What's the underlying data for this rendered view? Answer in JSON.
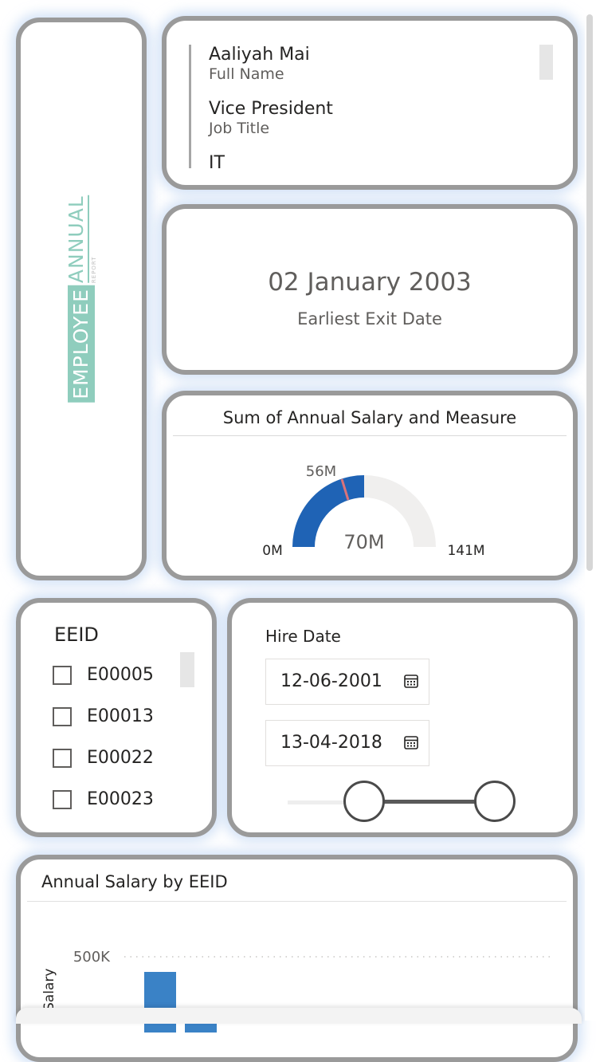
{
  "logo": {
    "word1": "EMPLOYEE",
    "word2": "ANNUAL",
    "word3": "REPORT"
  },
  "employee_card": {
    "fields": [
      {
        "value": "Aaliyah Mai",
        "label": "Full Name"
      },
      {
        "value": "Vice President",
        "label": "Job Title"
      },
      {
        "value": "IT",
        "label": ""
      }
    ]
  },
  "exit_kpi": {
    "value": "02 January 2003",
    "label": "Earliest Exit Date"
  },
  "gauge": {
    "title": "Sum of Annual Salary and Measure",
    "min_label": "0M",
    "max_label": "141M",
    "target_label": "56M",
    "value_label": "70M",
    "colors": {
      "fill": "#1f63b5",
      "track": "#f0efee",
      "target": "#d9737a"
    }
  },
  "eeid_slicer": {
    "title": "EEID",
    "items": [
      "E00005",
      "E00013",
      "E00022",
      "E00023"
    ]
  },
  "hire_slicer": {
    "title": "Hire Date",
    "start": "12-06-2001",
    "end": "13-04-2018"
  },
  "bar_chart_title": "Annual Salary by EEID",
  "chart_data": {
    "type": "bar",
    "title": "Annual Salary by EEID",
    "ylabel": "Salary",
    "xlabel": "",
    "y_tick_labels": [
      "500K"
    ],
    "ylim": [
      0,
      500000
    ],
    "values": [
      400000,
      80000
    ],
    "bar_color": "#3a82c6"
  }
}
